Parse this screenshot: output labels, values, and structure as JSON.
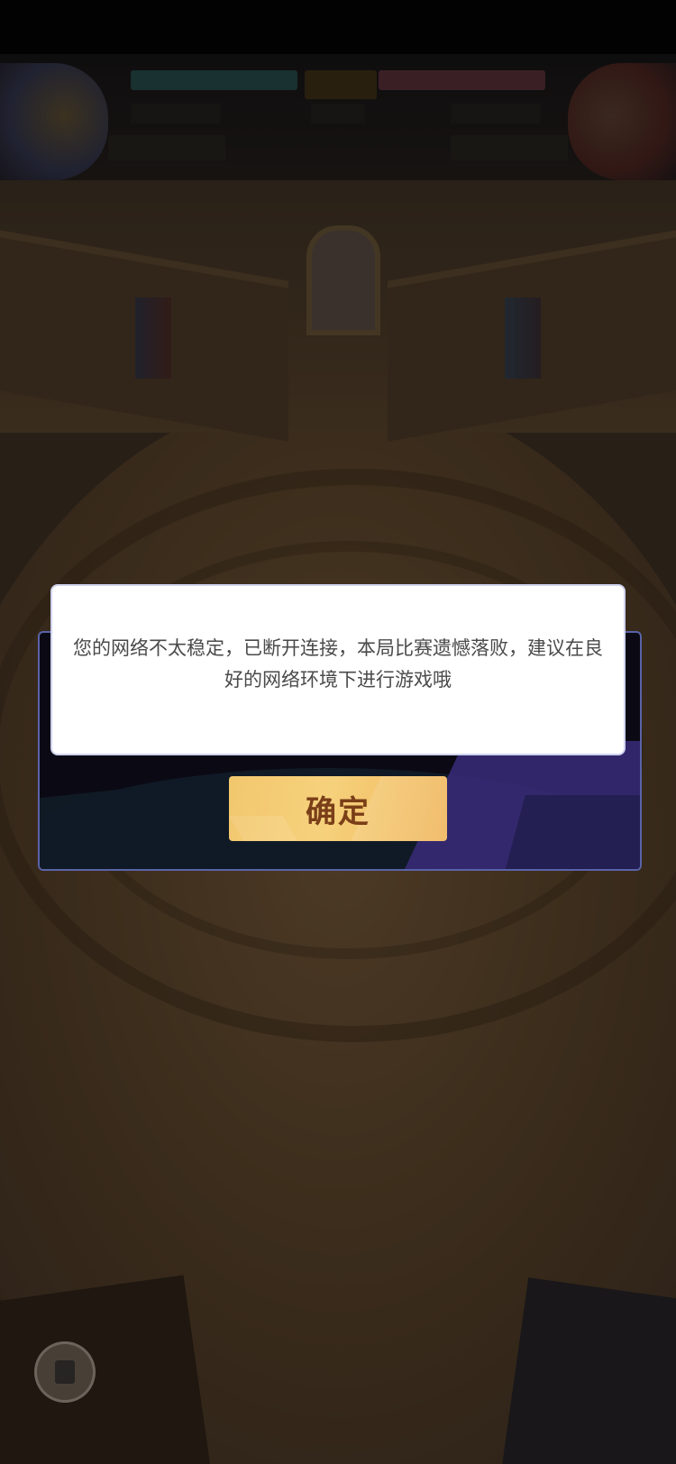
{
  "dialog": {
    "message": "您的网络不太稳定，已断开连接，本局比赛遗憾落败，建议在良好的网络环境下进行游戏哦",
    "confirm_label": "确定"
  },
  "icons": {
    "chat": "chat-icon"
  }
}
